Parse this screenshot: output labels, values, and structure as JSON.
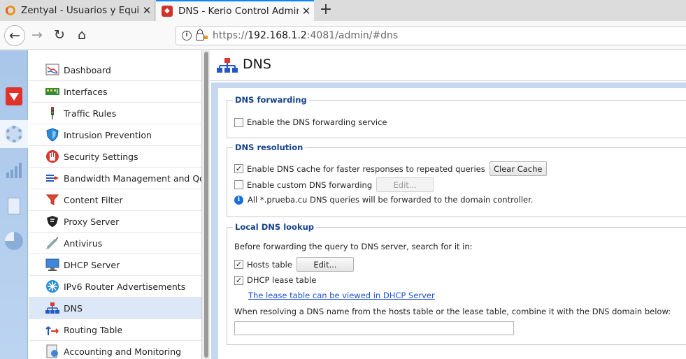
{
  "browser": {
    "tabs": [
      {
        "title": "Zentyal - Usuarios y Equipos",
        "close": "✕"
      },
      {
        "title": "DNS - Kerio Control Administration",
        "close": "✕"
      }
    ],
    "new_tab": "+",
    "url_scheme": "https://",
    "url_host": "192.168.1.2",
    "url_rest": ":4081/admin/#dns"
  },
  "nav": {
    "items": [
      {
        "label": "Dashboard",
        "icon": "dashboard-icon"
      },
      {
        "label": "Interfaces",
        "icon": "interfaces-icon"
      },
      {
        "label": "Traffic Rules",
        "icon": "traffic-light-icon"
      },
      {
        "label": "Intrusion Prevention",
        "icon": "shield-icon"
      },
      {
        "label": "Security Settings",
        "icon": "hand-icon"
      },
      {
        "label": "Bandwidth Management and QoS",
        "icon": "bandwidth-icon"
      },
      {
        "label": "Content Filter",
        "icon": "funnel-icon"
      },
      {
        "label": "Proxy Server",
        "icon": "proxy-shield-icon"
      },
      {
        "label": "Antivirus",
        "icon": "syringe-icon"
      },
      {
        "label": "DHCP Server",
        "icon": "monitor-icon"
      },
      {
        "label": "IPv6 Router Advertisements",
        "icon": "ipv6-icon"
      },
      {
        "label": "DNS",
        "icon": "dns-tree-icon",
        "selected": true
      },
      {
        "label": "Routing Table",
        "icon": "routing-icon"
      },
      {
        "label": "Accounting and Monitoring",
        "icon": "accounting-icon"
      }
    ]
  },
  "page": {
    "title": "DNS",
    "forwarding": {
      "legend": "DNS forwarding",
      "enable_label": "Enable the DNS forwarding service",
      "enable_checked": false
    },
    "resolution": {
      "legend": "DNS resolution",
      "cache_label": "Enable DNS cache for faster responses to repeated queries",
      "cache_checked": true,
      "clear_cache": "Clear Cache",
      "custom_label": "Enable custom DNS forwarding",
      "custom_checked": false,
      "edit": "Edit...",
      "info": "All *.prueba.cu DNS queries will be forwarded to the domain controller."
    },
    "lookup": {
      "legend": "Local DNS lookup",
      "intro": "Before forwarding the query to DNS server, search for it in:",
      "hosts_label": "Hosts table",
      "hosts_checked": true,
      "hosts_edit": "Edit...",
      "dhcp_label": "DHCP lease table",
      "dhcp_checked": true,
      "lease_link": "The lease table can be viewed in DHCP Server",
      "combine_label": "When resolving a DNS name from the hosts table or the lease table, combine it with the DNS domain below:",
      "domain_value": ""
    }
  }
}
